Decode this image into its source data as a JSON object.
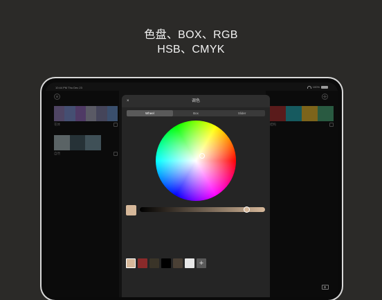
{
  "promo": {
    "line1": "色盘、BOX、RGB",
    "line2": "HSB、CMYK"
  },
  "status": {
    "time": "10:44 PM  Thu Dec 23",
    "battery": "100%"
  },
  "left_cards": [
    {
      "label": "花体",
      "colors": [
        "#7a6a9a",
        "#6a7ab0",
        "#7a5a9c",
        "#8a8a9c",
        "#6a6a8a",
        "#5a7aa8"
      ]
    },
    {
      "label": "自然",
      "colors": [
        "#8b989c",
        "#3b4d55",
        "#627b86"
      ]
    }
  ],
  "right_card": {
    "label": "结构",
    "colors": [
      "#8a2a2a",
      "#238b93",
      "#c19a2a",
      "#3f8a64"
    ]
  },
  "sheet": {
    "title": "调色",
    "close": "×",
    "tabs": [
      "Wheel",
      "Box",
      "Slider"
    ],
    "active_tab": "Wheel"
  },
  "picker": {
    "selected_color": "#d6b89a",
    "brightness": 0.85,
    "wheel_handle": {
      "hue_deg": 40,
      "saturation": 0.2
    },
    "recent_swatches": [
      "#d6b89a",
      "#8a2a2a",
      "#3a3428",
      "#000000",
      "#4a4035",
      "#e8e8e8"
    ],
    "add_label": "+"
  },
  "icons": {
    "settings": "gear-icon",
    "add": "add-icon",
    "edit": "edit-icon",
    "camera": "camera-icon"
  }
}
